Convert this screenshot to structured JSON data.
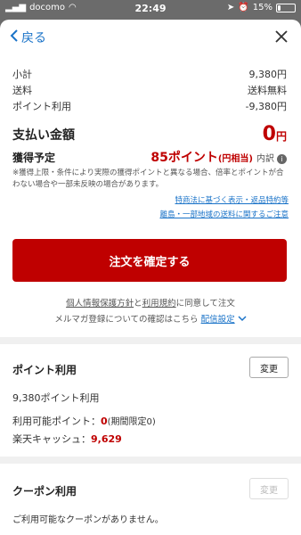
{
  "status_bar": {
    "carrier": "docomo",
    "time": "22:49",
    "battery": "15%",
    "battery_level": 0.15
  },
  "nav": {
    "back_label": "戻る"
  },
  "summary": {
    "rows": [
      {
        "label": "小計",
        "value": "9,380円"
      },
      {
        "label": "送料",
        "value": "送料無料"
      },
      {
        "label": "ポイント利用",
        "value": "-9,380円"
      }
    ],
    "total_label": "支払い金額",
    "total_amount": "0",
    "total_unit": "円"
  },
  "earn": {
    "label": "獲得予定",
    "points": "85ポイント",
    "points_note": "(円相当)",
    "breakdown": "内訳",
    "disclaimer": "※獲得上限・条件により実際の獲得ポイントと異なる場合、倍率とポイントが合わない場合や一部未反映の場合があります。"
  },
  "links": {
    "tokushoho": "特商法に基づく表示・返品特約等",
    "remote_shipping": "離島・一部地域の送料に関するご注意"
  },
  "confirm_button": "注文を確定する",
  "agreement": {
    "privacy": "個人情報保護方針",
    "and": "と",
    "terms": "利用規約",
    "suffix": "に同意して注文",
    "newsletter_text": "メルマガ登録についての確認はこちら",
    "delivery_settings": "配信設定"
  },
  "points_section": {
    "title": "ポイント利用",
    "change_label": "変更",
    "usage": "9,380ポイント利用",
    "available_label": "利用可能ポイント：",
    "available_value": "0",
    "available_note": "(期間限定0)",
    "cash_label": "楽天キャッシュ：",
    "cash_value": "9,629"
  },
  "coupon_section": {
    "title": "クーポン利用",
    "change_label": "変更",
    "none_text": "ご利用可能なクーポンがありません。"
  },
  "colors": {
    "accent": "#bf0000",
    "link": "#1a73c8"
  }
}
